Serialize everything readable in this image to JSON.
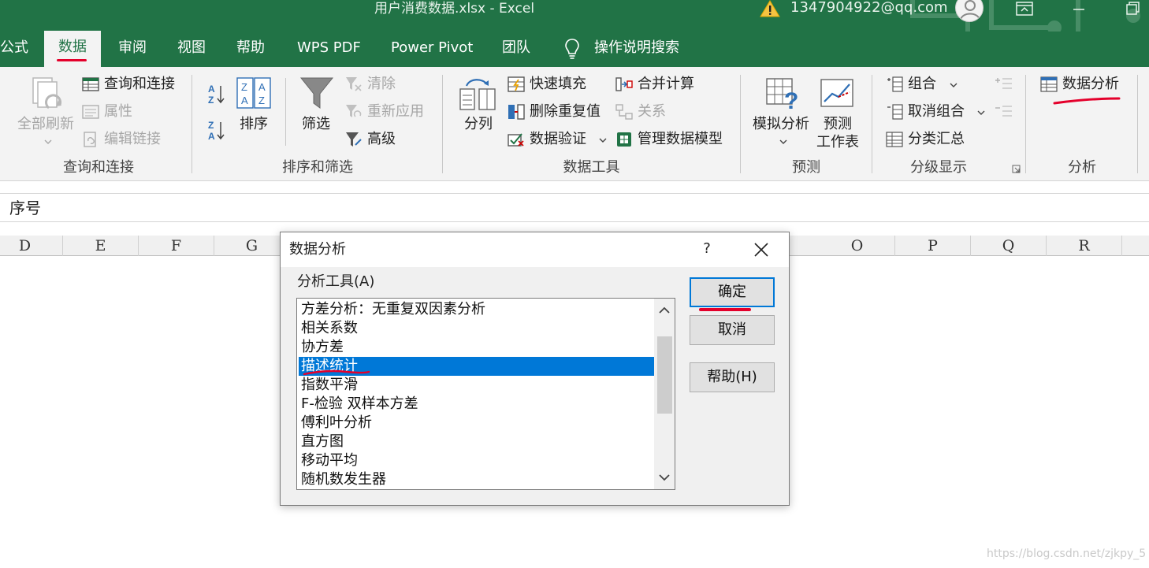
{
  "window": {
    "title": "用户消费数据.xlsx  -  Excel",
    "account": "1347904922@qq.com"
  },
  "tabs": [
    {
      "label": "公式"
    },
    {
      "label": "数据"
    },
    {
      "label": "审阅"
    },
    {
      "label": "视图"
    },
    {
      "label": "帮助"
    },
    {
      "label": "WPS PDF"
    },
    {
      "label": "Power Pivot"
    },
    {
      "label": "团队"
    },
    {
      "label": "操作说明搜索"
    }
  ],
  "ribbon": {
    "query": {
      "refresh_all": "全部刷新",
      "queries_connections": "查询和连接",
      "properties": "属性",
      "edit_links": "编辑链接",
      "group_label": "查询和连接"
    },
    "sort_filter": {
      "sort": "排序",
      "filter": "筛选",
      "clear": "清除",
      "reapply": "重新应用",
      "advanced": "高级",
      "group_label": "排序和筛选"
    },
    "data_tools": {
      "text_to_columns": "分列",
      "flash_fill": "快速填充",
      "remove_duplicates": "删除重复值",
      "data_validation": "数据验证",
      "consolidate": "合并计算",
      "relationships": "关系",
      "manage_data_model": "管理数据模型",
      "group_label": "数据工具"
    },
    "forecast": {
      "what_if": "模拟分析",
      "forecast_sheet_1": "预测",
      "forecast_sheet_2": "工作表",
      "group_label": "预测"
    },
    "outline": {
      "group": "组合",
      "ungroup": "取消组合",
      "subtotal": "分类汇总",
      "group_label": "分级显示"
    },
    "analysis": {
      "data_analysis": "数据分析",
      "group_label": "分析"
    }
  },
  "formula_bar": {
    "content": "序号"
  },
  "columns": [
    "D",
    "E",
    "F",
    "G",
    "O",
    "P",
    "Q",
    "R"
  ],
  "dialog": {
    "title": "数据分析",
    "help_symbol": "?",
    "tools_label": "分析工具(A)",
    "tools": [
      "方差分析：无重复双因素分析",
      "相关系数",
      "协方差",
      "描述统计",
      "指数平滑",
      "F-检验 双样本方差",
      "傅利叶分析",
      "直方图",
      "移动平均",
      "随机数发生器"
    ],
    "selected_index": 3,
    "ok": "确定",
    "cancel": "取消",
    "help": "帮助(H)"
  },
  "watermark": "https://blog.csdn.net/zjkpy_5",
  "colors": {
    "excel_green": "#217346",
    "selection_blue": "#0078d7",
    "annotation_red": "#e4002b"
  }
}
